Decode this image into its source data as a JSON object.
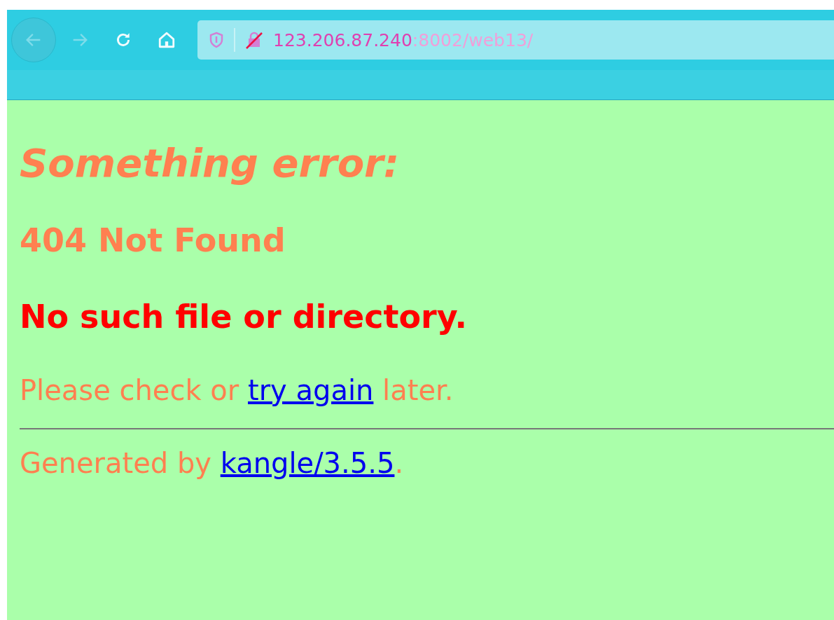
{
  "toolbar": {
    "back": {
      "disabled": true
    },
    "forward": {
      "disabled": true
    },
    "url": {
      "host": "123.206.87.240",
      "path": ":8002/web13/"
    }
  },
  "page": {
    "title": "Something error:",
    "status": "404 Not Found",
    "message": "No such file or directory.",
    "hint": {
      "before": "Please check or",
      "link": "try again",
      "after": "later."
    },
    "footer": {
      "before": "Generated by",
      "link": "kangle/3.5.5",
      "after": "."
    }
  }
}
